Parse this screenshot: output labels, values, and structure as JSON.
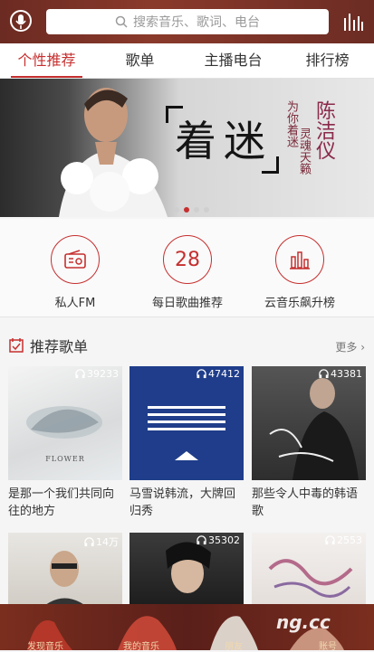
{
  "header": {
    "search_placeholder": "搜索音乐、歌词、电台",
    "icons": [
      "mic-icon",
      "search-icon",
      "equalizer-icon"
    ]
  },
  "tabs": [
    {
      "label": "个性推荐",
      "active": true
    },
    {
      "label": "歌单",
      "active": false
    },
    {
      "label": "主播电台",
      "active": false
    },
    {
      "label": "排行榜",
      "active": false
    }
  ],
  "banner": {
    "title": "着迷",
    "subtitle_1": "为你着迷",
    "subtitle_2": "灵魂天籁",
    "artist": "陈洁仪",
    "pager_count": 4,
    "pager_active": 1
  },
  "quick": [
    {
      "label": "私人FM",
      "icon": "radio-icon"
    },
    {
      "label": "每日歌曲推荐",
      "number": "28"
    },
    {
      "label": "云音乐飙升榜",
      "icon": "bar-chart-icon"
    }
  ],
  "section": {
    "title": "推荐歌单",
    "more": "更多"
  },
  "playlists": [
    {
      "count": "39233",
      "title": "是那一个我们共同向往的地方",
      "cover_text": "FLOWER"
    },
    {
      "count": "47412",
      "title": "马雪说韩流，大牌回归秀"
    },
    {
      "count": "43381",
      "title": "那些令人中毒的韩语歌"
    },
    {
      "count": "14万"
    },
    {
      "count": "35302"
    },
    {
      "count": "2553"
    }
  ],
  "bottom_nav": [
    "发现音乐",
    "我的音乐",
    "朋友",
    "账号"
  ],
  "watermark": "ng.cc",
  "colors": {
    "accent": "#c62f2f",
    "header": "#7a2e22"
  }
}
